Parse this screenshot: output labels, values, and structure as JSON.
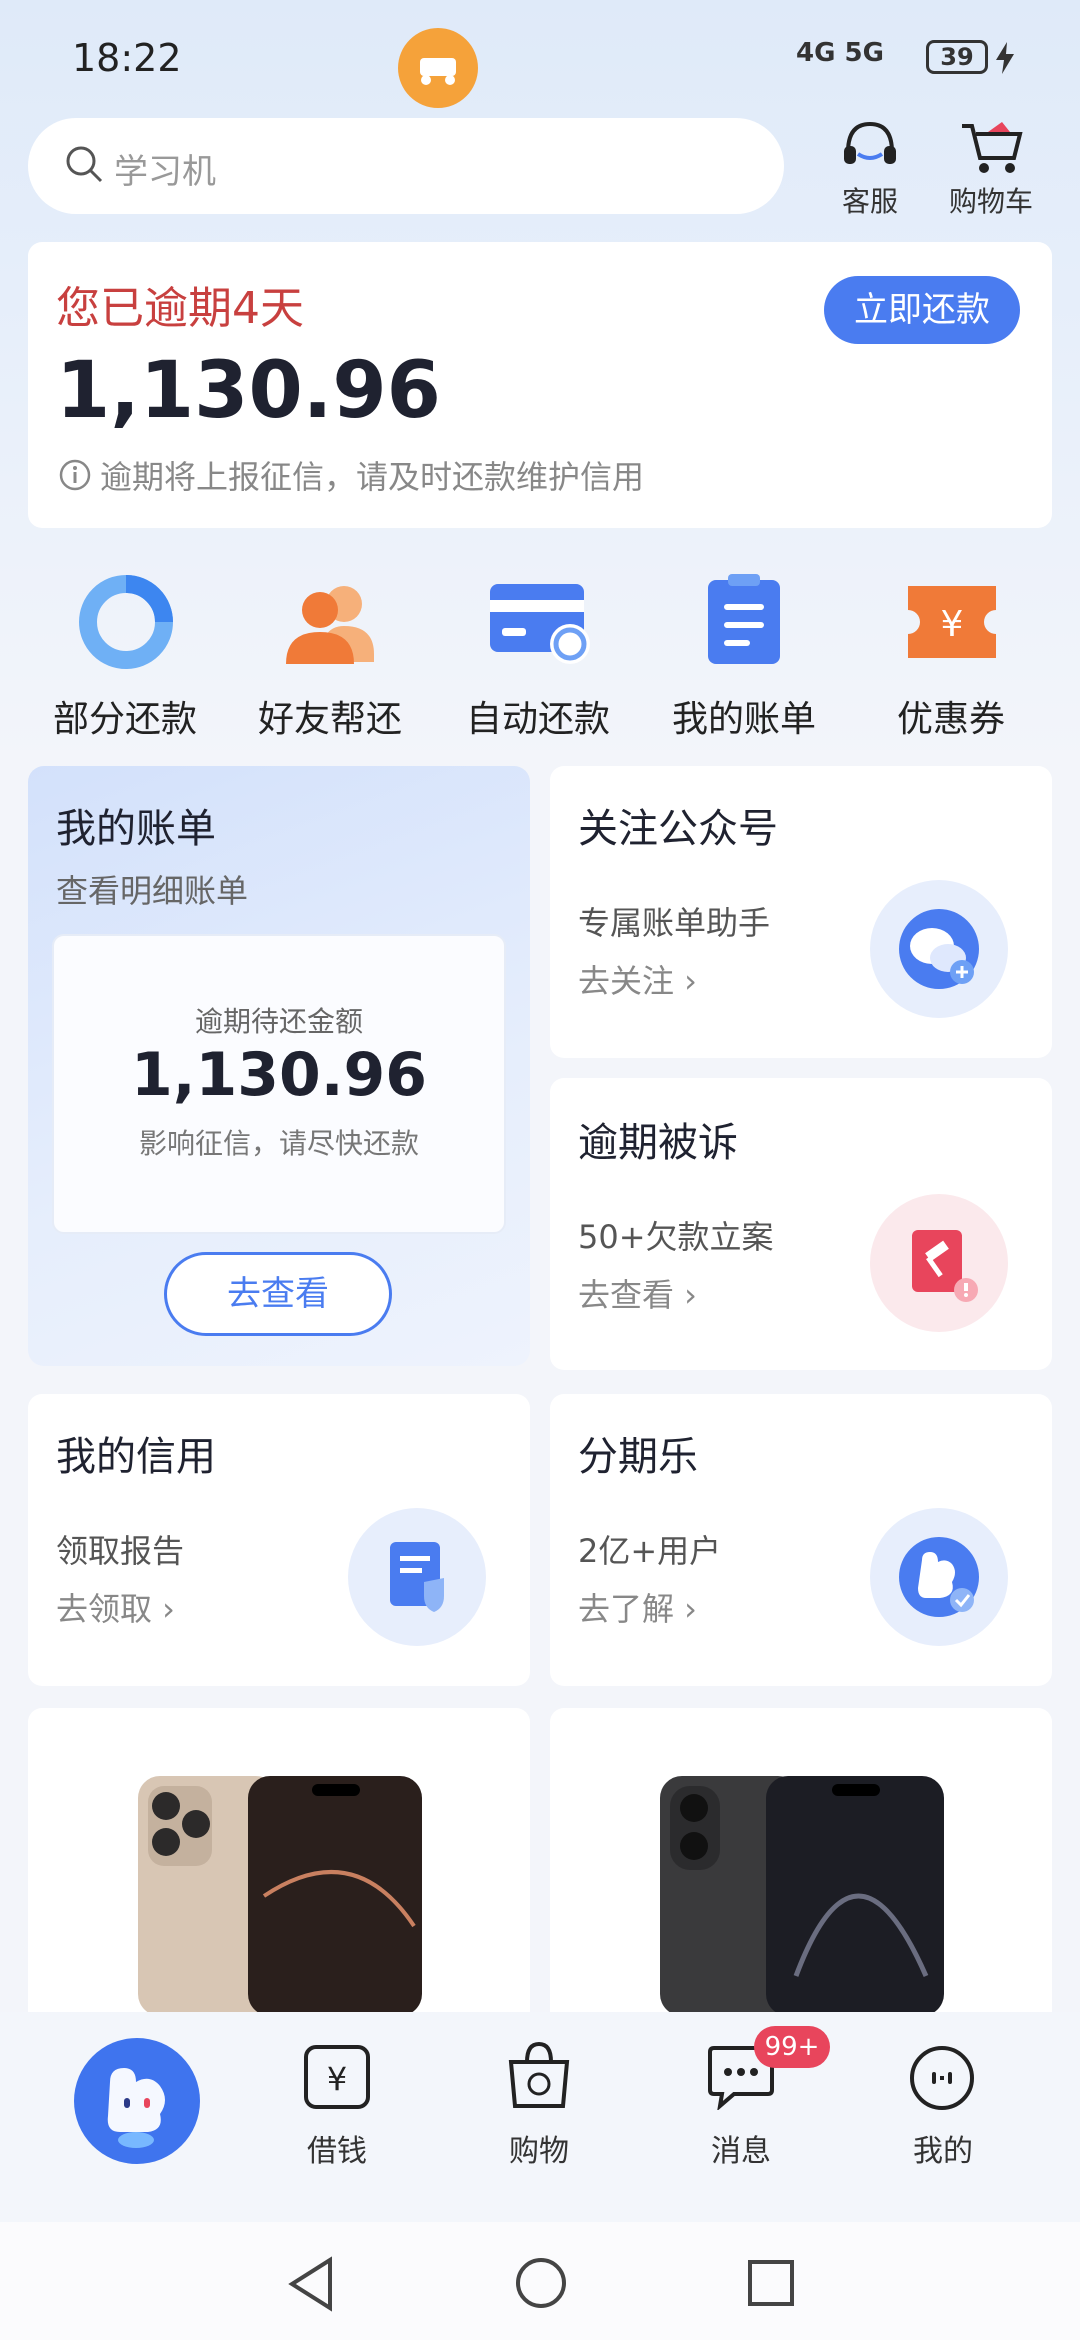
{
  "status": {
    "time": "18:22",
    "network": "4G 5G",
    "battery": "39"
  },
  "search": {
    "placeholder": "学习机"
  },
  "header": {
    "service": "客服",
    "cart": "购物车"
  },
  "alert": {
    "title": "您已逾期4天",
    "amount": "1,130.96",
    "note": "逾期将上报征信，请及时还款维护信用",
    "button": "立即还款"
  },
  "quick_actions": [
    {
      "label": "部分还款"
    },
    {
      "label": "好友帮还"
    },
    {
      "label": "自动还款"
    },
    {
      "label": "我的账单"
    },
    {
      "label": "优惠券"
    }
  ],
  "bill_card": {
    "title": "我的账单",
    "subtitle": "查看明细账单",
    "inner_label": "逾期待还金额",
    "inner_amount": "1,130.96",
    "inner_note": "影响征信，请尽快还款",
    "button": "去查看"
  },
  "follow_card": {
    "title": "关注公众号",
    "sub": "专属账单助手",
    "link": "去关注 ›"
  },
  "lawsuit_card": {
    "title": "逾期被诉",
    "sub": "50+欠款立案",
    "link": "去查看 ›"
  },
  "credit_card": {
    "title": "我的信用",
    "sub": "领取报告",
    "link": "去领取 ›"
  },
  "installment_card": {
    "title": "分期乐",
    "sub": "2亿+用户",
    "link": "去了解 ›"
  },
  "nav": {
    "items": [
      {
        "label": "借钱"
      },
      {
        "label": "购物"
      },
      {
        "label": "消息"
      },
      {
        "label": "我的"
      }
    ],
    "badge": "99+"
  },
  "colors": {
    "accent": "#4a7cf0",
    "alert": "#c8403f",
    "orange": "#f07a38"
  }
}
